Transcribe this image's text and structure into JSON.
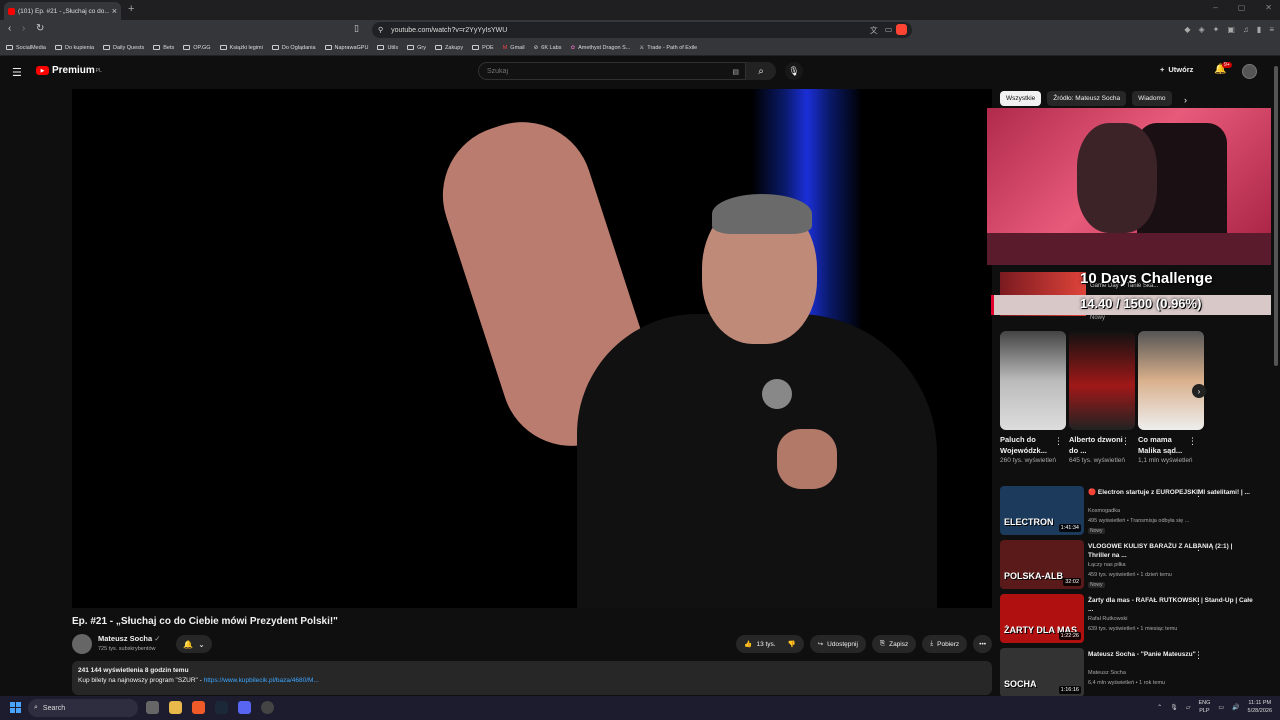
{
  "browser": {
    "tab_title": "(101) Ep. #21 - „Słuchaj co do...",
    "new_tab": "+",
    "url": "youtube.com/watch?v=r2YyYyIsYWU",
    "bookmarks": [
      "SocialMedia",
      "Do kupienia",
      "Daily Quests",
      "Bets",
      "OP.GG",
      "Książki legimi",
      "Do Oglądania",
      "NaprawaGPU",
      "Utils",
      "Gry",
      "Zakupy",
      "POE",
      "Gmail",
      "6K Labs",
      "Amethyst Dragon S...",
      "Trade - Path of Exile"
    ]
  },
  "yt_header": {
    "brand": "Premium",
    "region": "PL",
    "search_placeholder": "Szukaj",
    "create_label": "Utwórz",
    "notifications_badge": "9+"
  },
  "video": {
    "title": "Ep. #21 - „Słuchaj co do Ciebie mówi Prezydent Polski!\"",
    "channel": "Mateusz Socha",
    "subscribers": "725 tys. subskrybentów",
    "likes": "13 tys.",
    "share_label": "Udostępnij",
    "save_label": "Zapisz",
    "download_label": "Pobierz",
    "views_line": "241 144 wyświetlenia  8 godzin temu",
    "desc_text": "Kup bilety na najnowszy program \"SZUR\" - ",
    "desc_link": "https://www.kupbilecik.pl/baza/4680/M..."
  },
  "sidebar": {
    "chips": [
      "Wszystkie",
      "Źródło: Mateusz Socha",
      "Wiadomo"
    ],
    "challenge": {
      "title": "10 Days Challenge",
      "progress_text": "14.40 / 1500 (0.96%)",
      "progress_fraction": 0.0096,
      "sub": "Game Day 1: Tanie Ska...",
      "badge": "Nowy"
    },
    "shorts": [
      {
        "title": "Paluch do Wojewódzk...",
        "views": "260 tys. wyświetleń"
      },
      {
        "title": "Alberto dzwoni do ...",
        "views": "645 tys. wyświetleń"
      },
      {
        "title": "Co mama Malika sąd...",
        "views": "1,1 mln wyświetleń"
      }
    ],
    "videos": [
      {
        "title": "🔴 Electron startuje z EUROPEJSKIMI satelitami! | ...",
        "channel": "Kosmogadka",
        "meta": "495 wyświetleń • Transmisja odbyła się ...",
        "duration": "1:41:34",
        "badge": "Nowy",
        "thumb_label": "ELECTRON",
        "color": "#1b3a5c"
      },
      {
        "title": "VLOGOWE KULISY BARAŻU Z ALBANIĄ (2:1) | Thriller na ...",
        "channel": "Łączy nas piłka",
        "meta": "459 tys. wyświetleń • 1 dzień temu",
        "duration": "32:02",
        "badge": "Nowy",
        "thumb_label": "POLSKA-ALB",
        "color": "#5a1a1a"
      },
      {
        "title": "Żarty dla mas - RAFAŁ RUTKOWSKI | Stand-Up | Całe ...",
        "channel": "Rafał Rutkowski",
        "meta": "639 tys. wyświetleń • 1 miesiąc temu",
        "duration": "1:22:26",
        "badge": "",
        "thumb_label": "ŻARTY DLA MAS",
        "color": "#b01010"
      },
      {
        "title": "Mateusz Socha - \"Panie Mateuszu\"",
        "channel": "Mateusz Socha",
        "meta": "6,4 mln wyświetleń • 1 rok temu",
        "duration": "1:16:16",
        "badge": "",
        "thumb_label": "SOCHA",
        "color": "#333"
      }
    ]
  },
  "taskbar": {
    "search": "Search",
    "lang1": "ENG",
    "lang2": "PLP",
    "time": "11:11 PM",
    "date": "5/28/2026"
  }
}
